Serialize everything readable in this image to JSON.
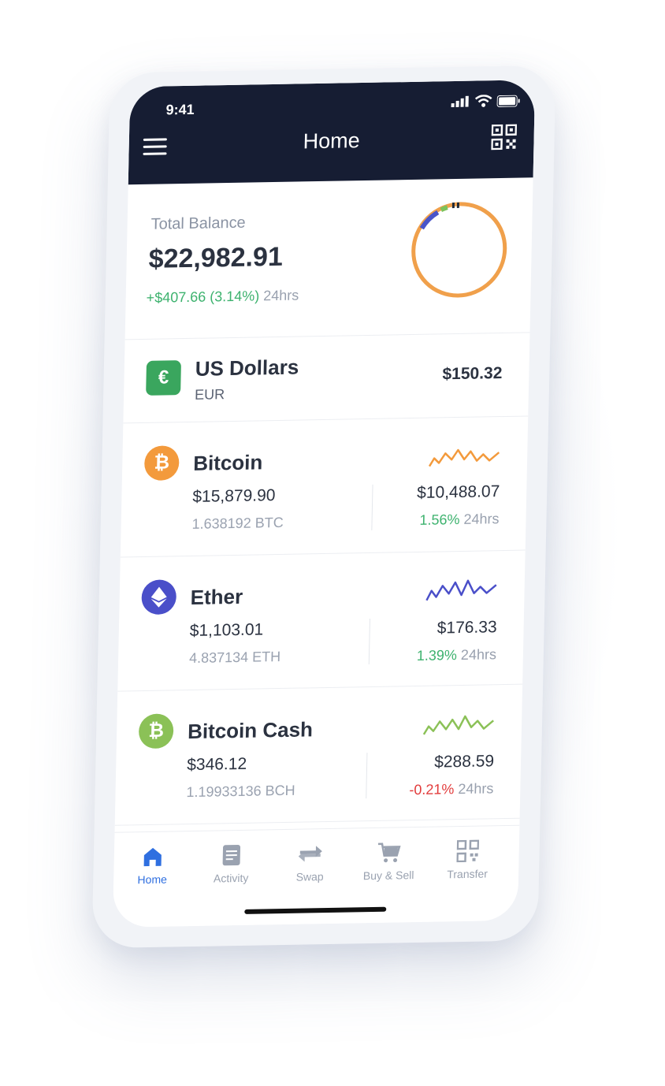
{
  "status_bar": {
    "time": "9:41"
  },
  "header": {
    "title": "Home"
  },
  "balance": {
    "label": "Total Balance",
    "amount": "$22,982.91",
    "change": "+$407.66 (3.14%)",
    "period": "24hrs",
    "allocation_colors": [
      "#f0a04b",
      "#4a55c9",
      "#7cc35b",
      "#1f2937"
    ]
  },
  "cash": {
    "name": "US Dollars",
    "code": "EUR",
    "value": "$150.32",
    "icon": "euro-icon",
    "color": "#3aa65e"
  },
  "coins": [
    {
      "name": "Bitcoin",
      "value": "$15,879.90",
      "holding": "1.638192 BTC",
      "price": "$10,488.07",
      "change": "1.56%",
      "period": "24hrs",
      "trend": "up",
      "color": "#f39a3c",
      "icon": "bitcoin-icon"
    },
    {
      "name": "Ether",
      "value": "$1,103.01",
      "holding": "4.837134 ETH",
      "price": "$176.33",
      "change": "1.39%",
      "period": "24hrs",
      "trend": "up",
      "color": "#4a4fc9",
      "icon": "ethereum-icon"
    },
    {
      "name": "Bitcoin Cash",
      "value": "$346.12",
      "holding": "1.19933136 BCH",
      "price": "$288.59",
      "change": "-0.21%",
      "period": "24hrs",
      "trend": "down",
      "color": "#8bc157",
      "icon": "bitcoin-cash-icon"
    }
  ],
  "tabs": [
    {
      "label": "Home",
      "icon": "home-icon",
      "active": true
    },
    {
      "label": "Activity",
      "icon": "activity-icon",
      "active": false
    },
    {
      "label": "Swap",
      "icon": "swap-icon",
      "active": false
    },
    {
      "label": "Buy & Sell",
      "icon": "cart-icon",
      "active": false
    },
    {
      "label": "Transfer",
      "icon": "qr-icon",
      "active": false
    }
  ]
}
